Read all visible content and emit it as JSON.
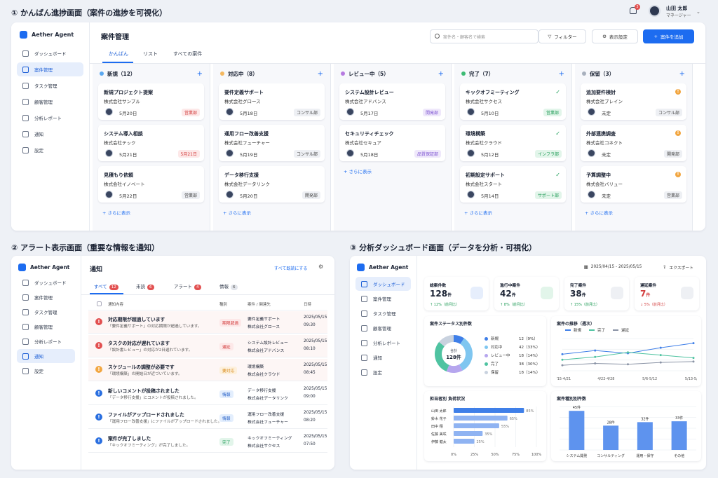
{
  "topbar": {
    "notif_count": "3",
    "user_name": "山田 太郎",
    "user_role": "マネージャー"
  },
  "screen1": {
    "caption": "① かんばん進捗画面（案件の進捗を可視化）",
    "app_name": "Aether Agent",
    "nav": [
      "ダッシュボード",
      "案件管理",
      "タスク管理",
      "顧客管理",
      "分析レポート",
      "通知",
      "設定"
    ],
    "page_title": "案件管理",
    "search_placeholder": "案件名・顧客名で検索",
    "filter_label": "フィルター",
    "display_settings_label": "表示設定",
    "add_label": "案件を追加",
    "tabs": [
      "かんばん",
      "リスト",
      "すべての案件"
    ],
    "more_label": "+ さらに表示",
    "columns": [
      {
        "title": "新規（12）",
        "color": "#5aa8f0",
        "cards": [
          {
            "title": "新規プロジェクト提案",
            "company": "株式会社サンプル",
            "date": "5月20日",
            "tag": "営業部",
            "tag_style": "red"
          },
          {
            "title": "システム導入相談",
            "company": "株式会社テック",
            "date": "5月21日",
            "tag": "5月21日",
            "tag_style": "red"
          },
          {
            "title": "見積もり依頼",
            "company": "株式会社イノベート",
            "date": "5月22日",
            "tag": "営業部",
            "tag_style": "grey"
          }
        ]
      },
      {
        "title": "対応中（8）",
        "color": "#f4b860",
        "cards": [
          {
            "title": "要件定義サポート",
            "company": "株式会社グロース",
            "date": "5月18日",
            "tag": "コンサル部",
            "tag_style": "grey"
          },
          {
            "title": "運用フロー改善支援",
            "company": "株式会社フューチャー",
            "date": "5月19日",
            "tag": "コンサル部",
            "tag_style": "grey"
          },
          {
            "title": "データ移行支援",
            "company": "株式会社データリンク",
            "date": "5月20日",
            "tag": "開発部",
            "tag_style": "grey"
          }
        ]
      },
      {
        "title": "レビュー中（5）",
        "color": "#b67ae0",
        "cards": [
          {
            "title": "システム設計レビュー",
            "company": "株式会社アドバンス",
            "date": "5月17日",
            "tag": "開発部",
            "tag_style": "purple"
          },
          {
            "title": "セキュリティチェック",
            "company": "株式会社セキュア",
            "date": "5月18日",
            "tag": "品質保証部",
            "tag_style": "purple"
          }
        ]
      },
      {
        "title": "完了（7）",
        "color": "#3dbb74",
        "cards": [
          {
            "title": "キックオフミーティング",
            "company": "株式会社サクセス",
            "date": "5月10日",
            "tag": "営業部",
            "tag_style": "green"
          },
          {
            "title": "環境構築",
            "company": "株式会社クラウド",
            "date": "5月12日",
            "tag": "インフラ部",
            "tag_style": "green"
          },
          {
            "title": "初期設定サポート",
            "company": "株式会社スタート",
            "date": "5月14日",
            "tag": "サポート部",
            "tag_style": "green"
          }
        ]
      },
      {
        "title": "保留（3）",
        "color": "#a8b0bd",
        "cards": [
          {
            "title": "追加要件検討",
            "company": "株式会社ブレイン",
            "date": "未定",
            "tag": "コンサル部",
            "tag_style": "grey"
          },
          {
            "title": "外部連携調査",
            "company": "株式会社コネクト",
            "date": "未定",
            "tag": "開発部",
            "tag_style": "grey"
          },
          {
            "title": "予算調整中",
            "company": "株式会社バリュー",
            "date": "未定",
            "tag": "営業部",
            "tag_style": "grey"
          }
        ]
      }
    ]
  },
  "screen2": {
    "caption": "② アラート表示画面（重要な情報を通知）",
    "app_name": "Aether Agent",
    "nav": [
      "ダッシュボード",
      "案件管理",
      "タスク管理",
      "顧客管理",
      "分析レポート",
      "通知",
      "設定"
    ],
    "title": "通知",
    "mark_read_label": "すべて既読にする",
    "tabs": [
      {
        "label": "すべて",
        "count": "12"
      },
      {
        "label": "未読",
        "count": "6"
      },
      {
        "label": "アラート",
        "count": "4"
      },
      {
        "label": "情報",
        "count": "6"
      }
    ],
    "columns": [
      "通知内容",
      "種別",
      "案件 / 関連先",
      "日時"
    ],
    "rows": [
      {
        "title": "対応期限が超過しています",
        "msg": "「要件定義サポート」の対応期限が超過しています。",
        "kind": "期限超過",
        "kind_style": "red",
        "icon": "!",
        "icon_color": "#e25050",
        "p1": "要件定義サポート",
        "p2": "株式会社グロース",
        "t1": "2025/05/15",
        "t2": "09:30"
      },
      {
        "title": "タスクの対応が遅れています",
        "msg": "「設計書レビュー」の対応が2日遅れています。",
        "kind": "遅延",
        "kind_style": "red",
        "icon": "!",
        "icon_color": "#e25050",
        "p1": "システム設計レビュー",
        "p2": "株式会社アドバンス",
        "t1": "2025/05/15",
        "t2": "08:10"
      },
      {
        "title": "スケジュールの調整が必要です",
        "msg": "「環境構築」の開始日が近づいています。",
        "kind": "要対応",
        "kind_style": "orange",
        "icon": "!",
        "icon_color": "#f2a640",
        "p1": "環境構築",
        "p2": "株式会社クラウド",
        "t1": "2025/05/15",
        "t2": "08:45"
      },
      {
        "title": "新しいコメントが投稿されました",
        "msg": "「データ移行支援」にコメントが投稿されました。",
        "kind": "情報",
        "kind_style": "blue",
        "icon": "!",
        "icon_color": "#2a6fe0",
        "p1": "データ移行支援",
        "p2": "株式会社データリンク",
        "t1": "2025/05/15",
        "t2": "09:00"
      },
      {
        "title": "ファイルがアップロードされました",
        "msg": "「運用フロー改善支援」にファイルがアップロードされました。",
        "kind": "情報",
        "kind_style": "blue",
        "icon": "!",
        "icon_color": "#2a6fe0",
        "p1": "運用フロー改善支援",
        "p2": "株式会社フューチャー",
        "t1": "2025/05/15",
        "t2": "08:20"
      },
      {
        "title": "案件が完了しました",
        "msg": "「キックオフミーティング」が完了しました。",
        "kind": "完了",
        "kind_style": "green",
        "icon": "!",
        "icon_color": "#2a6fe0",
        "p1": "キックオフミーティング",
        "p2": "株式会社サクセス",
        "t1": "2025/05/15",
        "t2": "07:50"
      }
    ]
  },
  "screen3": {
    "caption": "③ 分析ダッシュボード画面（データを分析・可視化）",
    "app_name": "Aether Agent",
    "nav": [
      "ダッシュボード",
      "案件管理",
      "タスク管理",
      "顧客管理",
      "分析レポート",
      "通知",
      "設定"
    ],
    "date_range": "2025/04/15 - 2025/05/15",
    "export_label": "エクスポート",
    "kpis": [
      {
        "label": "総案件数",
        "value": "128",
        "unit": "件",
        "sub": "↑ 12%（前月比）",
        "sub_color": "#1e9a55",
        "icon_bg": "#e6eefc"
      },
      {
        "label": "進行中案件",
        "value": "42",
        "unit": "件",
        "sub": "↑ 8%（前月比）",
        "sub_color": "#1e9a55",
        "icon_bg": "#e2f5ea"
      },
      {
        "label": "完了案件",
        "value": "38",
        "unit": "件",
        "sub": "↑ 15%（前月比）",
        "sub_color": "#1e9a55",
        "icon_bg": "#eef0f4"
      },
      {
        "label": "遅延案件",
        "value": "7",
        "unit": "件",
        "sub": "↓ 5%（前月比）",
        "sub_color": "#d23c3c",
        "icon_bg": "#eef0f4",
        "value_color": "#d23c3c"
      }
    ],
    "donut": {
      "title": "案件ステータス別件数",
      "center_label": "合計",
      "center_value": "128件",
      "items": [
        {
          "name": "新規",
          "text": "12（9%）",
          "value": 12,
          "color": "#3f7fe8"
        },
        {
          "name": "対応中",
          "text": "42（33%）",
          "value": 42,
          "color": "#7fc6f0"
        },
        {
          "name": "レビュー中",
          "text": "18（14%）",
          "value": 18,
          "color": "#b6a6ee"
        },
        {
          "name": "完了",
          "text": "38（30%）",
          "value": 38,
          "color": "#4fc3a1"
        },
        {
          "name": "保留",
          "text": "18（14%）",
          "value": 18,
          "color": "#c9d2df"
        }
      ]
    },
    "line": {
      "title": "案件の推移（週次）",
      "x": [
        "4/15-4/21",
        "4/22-4/28",
        "5/6-5/12",
        "5/13-5/19"
      ],
      "series": [
        {
          "name": "新規",
          "color": "#3f7fe8",
          "values": [
            18,
            22,
            19,
            25,
            30
          ]
        },
        {
          "name": "完了",
          "color": "#4fc3a1",
          "values": [
            12,
            15,
            20,
            17,
            14
          ]
        },
        {
          "name": "遅延",
          "color": "#8a93a5",
          "values": [
            6,
            8,
            7,
            9,
            10
          ]
        }
      ]
    },
    "hbar": {
      "title": "担当者別 負荷状況",
      "names": [
        "山田 太郎",
        "鈴木 花子",
        "田中 翔",
        "佐藤 美咲",
        "伊藤 健太"
      ],
      "values": [
        85,
        65,
        55,
        35,
        25
      ],
      "labels": [
        "85%",
        "65%",
        "55%",
        "35%",
        "25%"
      ],
      "ticks": [
        "0%",
        "25%",
        "50%",
        "75%",
        "100%"
      ]
    },
    "vbar": {
      "title": "案件種別別件数",
      "categories": [
        "システム開発",
        "コンサルティング",
        "運用・保守",
        "その他"
      ],
      "values": [
        45,
        28,
        32,
        33
      ],
      "labels": [
        "45件",
        "28件",
        "32件",
        "33件"
      ]
    }
  }
}
